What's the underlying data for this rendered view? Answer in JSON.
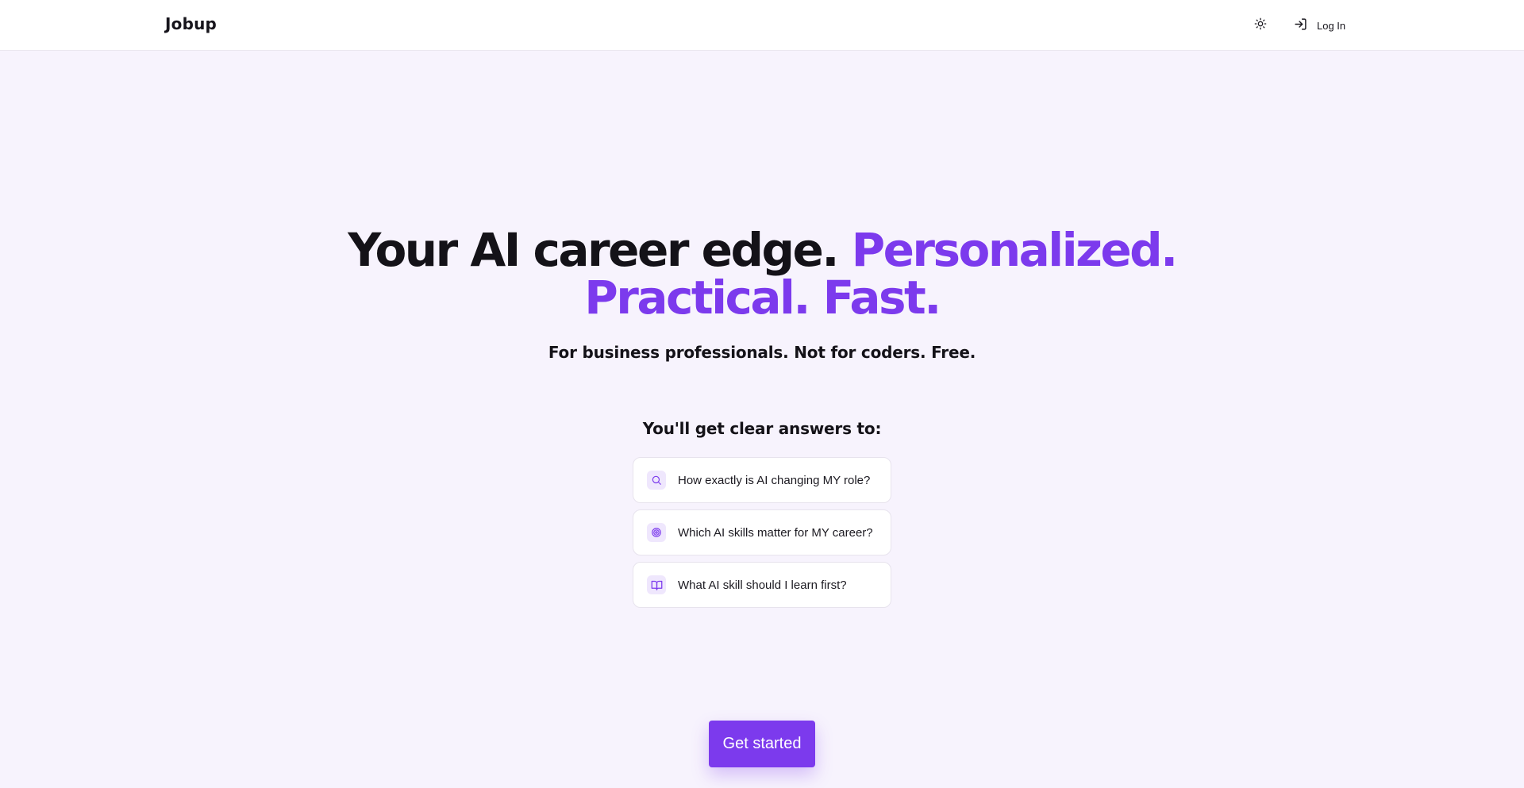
{
  "header": {
    "brand": "Jobup",
    "theme_toggle_icon": "sun-icon",
    "login_icon": "log-in-icon",
    "login_label": "Log In"
  },
  "hero": {
    "headline_part1": "Your AI career edge. ",
    "headline_accent1": "Personalized.",
    "headline_accent2": "Practical. Fast.",
    "subline": "For business professionals. Not for coders. Free."
  },
  "answers": {
    "title": "You'll get clear answers to:",
    "items": [
      {
        "icon": "search-icon",
        "text": "How exactly is AI changing MY role?"
      },
      {
        "icon": "target-icon",
        "text": "Which AI skills matter for MY career?"
      },
      {
        "icon": "book-open-icon",
        "text": "What AI skill should I learn first?"
      }
    ]
  },
  "cta": {
    "label": "Get started"
  },
  "colors": {
    "accent": "#7c3aed",
    "background": "#f7f3fd",
    "text": "#141218"
  }
}
